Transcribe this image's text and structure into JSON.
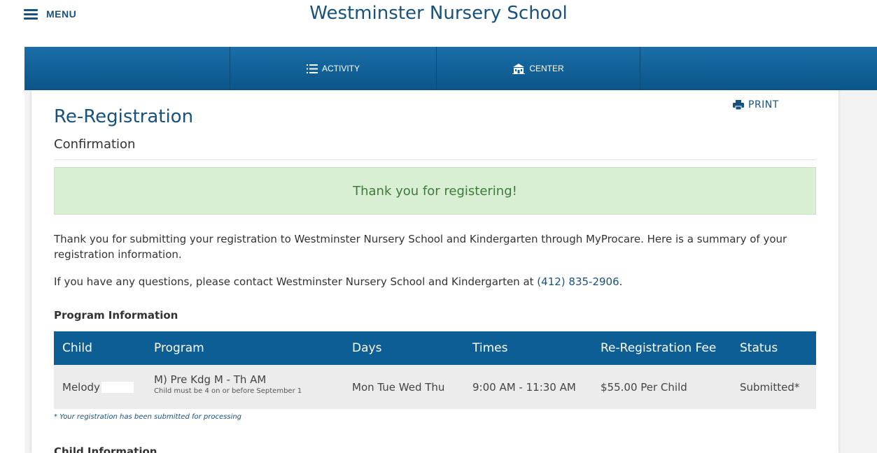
{
  "header": {
    "menu_label": "MENU",
    "site_title": "Westminster Nursery School"
  },
  "nav": {
    "items": [
      {
        "label": "ACTIVITY",
        "icon": "list-icon"
      },
      {
        "label": "CENTER",
        "icon": "school-building-icon"
      }
    ]
  },
  "page": {
    "print_label": "PRINT",
    "title": "Re-Registration",
    "subtitle": "Confirmation",
    "alert": "Thank you for registering!",
    "intro_line1": "Thank you for submitting your registration to Westminster Nursery School and Kindergarten through MyProcare. Here is a summary of your",
    "intro_line2": "registration information.",
    "contact_prefix": "If you have any questions, please contact Westminster Nursery School and Kindergarten at ",
    "contact_phone": "(412) 835-2906",
    "contact_suffix": ".",
    "program_section": "Program Information",
    "child_section": "Child Information"
  },
  "table": {
    "headers": [
      "Child",
      "Program",
      "Days",
      "Times",
      "Re-Registration Fee",
      "Status"
    ],
    "rows": [
      {
        "child": "Melody",
        "program": "M) Pre Kdg M - Th AM",
        "program_note": "Child must be 4 on or before September 1",
        "days": "Mon Tue Wed Thu",
        "times": "9:00 AM - 11:30 AM",
        "fee": "$55.00 Per Child",
        "status": "Submitted*"
      }
    ],
    "footnote": "* Your registration has been submitted for processing"
  },
  "colors": {
    "brand_blue": "#17527f",
    "nav_blue": "#0d5e94",
    "success_bg": "#d9efd4",
    "success_text": "#3c7a3a"
  }
}
